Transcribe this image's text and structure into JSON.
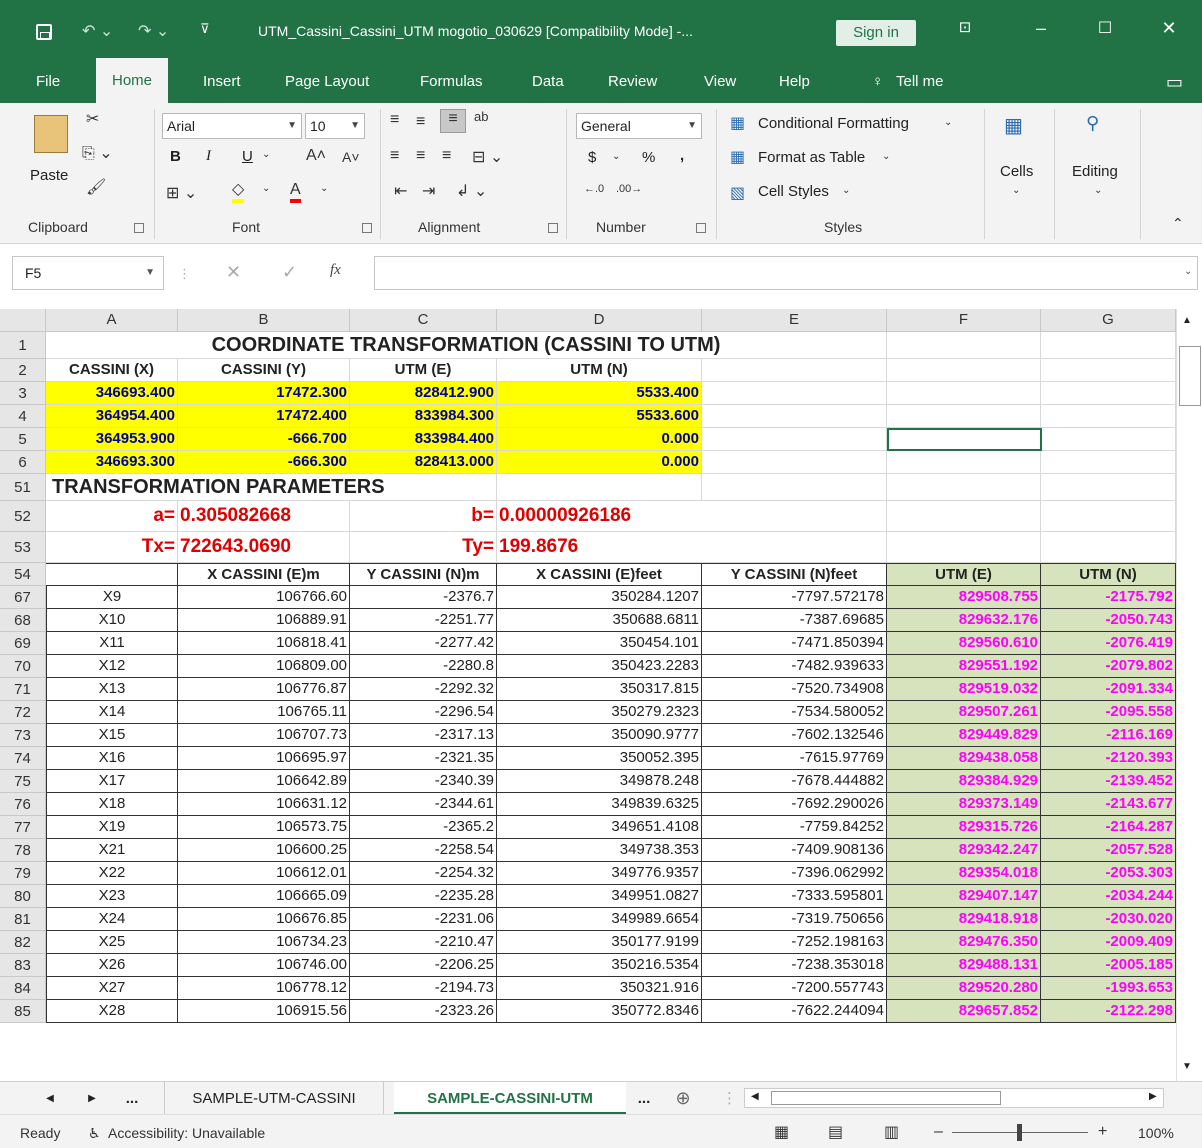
{
  "title_bar": {
    "title": "UTM_Cassini_Cassini_UTM mogotio_030629  [Compatibility Mode]  -...",
    "signin_label": "Sign in",
    "customize_glyph": "⊽"
  },
  "menu": {
    "file": "File",
    "home": "Home",
    "insert": "Insert",
    "page_layout": "Page Layout",
    "formulas": "Formulas",
    "data": "Data",
    "review": "Review",
    "view": "View",
    "help": "Help",
    "tell_me": "Tell me"
  },
  "ribbon": {
    "clipboard": {
      "label": "Clipboard",
      "paste": "Paste"
    },
    "font": {
      "label": "Font",
      "name": "Arial",
      "size": "10",
      "bold": "B",
      "italic": "I",
      "underline": "U"
    },
    "alignment": {
      "label": "Alignment"
    },
    "number": {
      "label": "Number",
      "format": "General",
      "currency": "$",
      "percent": "%",
      "comma": ","
    },
    "styles": {
      "label": "Styles",
      "conditional": "Conditional Formatting",
      "format_table": "Format as Table",
      "cell_styles": "Cell Styles"
    },
    "cells": {
      "label": "Cells"
    },
    "editing": {
      "label": "Editing"
    }
  },
  "formula_bar": {
    "name_box": "F5",
    "fx": "fx",
    "value": ""
  },
  "columns": [
    "A",
    "B",
    "C",
    "D",
    "E",
    "F",
    "G"
  ],
  "rows": [
    {
      "num": "1",
      "type": "title",
      "text": "COORDINATE TRANSFORMATION (CASSINI TO UTM)"
    },
    {
      "num": "2",
      "type": "hdr2",
      "cells": [
        "CASSINI (X)",
        "CASSINI (Y)",
        "UTM (E)",
        "UTM (N)"
      ]
    },
    {
      "num": "3",
      "type": "yellow",
      "cells": [
        "346693.400",
        "17472.300",
        "828412.900",
        "5533.400"
      ]
    },
    {
      "num": "4",
      "type": "yellow",
      "cells": [
        "364954.400",
        "17472.400",
        "833984.300",
        "5533.600"
      ]
    },
    {
      "num": "5",
      "type": "yellow",
      "cells": [
        "364953.900",
        "-666.700",
        "833984.400",
        "0.000"
      ]
    },
    {
      "num": "6",
      "type": "yellow",
      "cells": [
        "346693.300",
        "-666.300",
        "828413.000",
        "0.000"
      ]
    },
    {
      "num": "51",
      "type": "section",
      "text": "TRANSFORMATION PARAMETERS"
    },
    {
      "num": "52",
      "type": "param",
      "l1": "a=",
      "v1": "0.305082668",
      "l2": "b=",
      "v2": "0.00000926186"
    },
    {
      "num": "53",
      "type": "param",
      "l1": "Tx=",
      "v1": "722643.0690",
      "l2": "Ty=",
      "v2": "199.8676"
    },
    {
      "num": "54",
      "type": "hdr54",
      "cells": [
        "",
        "X CASSINI (E)m",
        "Y CASSINI (N)m",
        "X CASSINI (E)feet",
        "Y CASSINI (N)feet",
        "UTM (E)",
        "UTM (N)"
      ]
    },
    {
      "num": "67",
      "type": "data",
      "cells": [
        "X9",
        "106766.60",
        "-2376.7",
        "350284.1207",
        "-7797.572178",
        "829508.755",
        "-2175.792"
      ]
    },
    {
      "num": "68",
      "type": "data",
      "cells": [
        "X10",
        "106889.91",
        "-2251.77",
        "350688.6811",
        "-7387.69685",
        "829632.176",
        "-2050.743"
      ]
    },
    {
      "num": "69",
      "type": "data",
      "cells": [
        "X11",
        "106818.41",
        "-2277.42",
        "350454.101",
        "-7471.850394",
        "829560.610",
        "-2076.419"
      ]
    },
    {
      "num": "70",
      "type": "data",
      "cells": [
        "X12",
        "106809.00",
        "-2280.8",
        "350423.2283",
        "-7482.939633",
        "829551.192",
        "-2079.802"
      ]
    },
    {
      "num": "71",
      "type": "data",
      "cells": [
        "X13",
        "106776.87",
        "-2292.32",
        "350317.815",
        "-7520.734908",
        "829519.032",
        "-2091.334"
      ]
    },
    {
      "num": "72",
      "type": "data",
      "cells": [
        "X14",
        "106765.11",
        "-2296.54",
        "350279.2323",
        "-7534.580052",
        "829507.261",
        "-2095.558"
      ]
    },
    {
      "num": "73",
      "type": "data",
      "cells": [
        "X15",
        "106707.73",
        "-2317.13",
        "350090.9777",
        "-7602.132546",
        "829449.829",
        "-2116.169"
      ]
    },
    {
      "num": "74",
      "type": "data",
      "cells": [
        "X16",
        "106695.97",
        "-2321.35",
        "350052.395",
        "-7615.97769",
        "829438.058",
        "-2120.393"
      ]
    },
    {
      "num": "75",
      "type": "data",
      "cells": [
        "X17",
        "106642.89",
        "-2340.39",
        "349878.248",
        "-7678.444882",
        "829384.929",
        "-2139.452"
      ]
    },
    {
      "num": "76",
      "type": "data",
      "cells": [
        "X18",
        "106631.12",
        "-2344.61",
        "349839.6325",
        "-7692.290026",
        "829373.149",
        "-2143.677"
      ]
    },
    {
      "num": "77",
      "type": "data",
      "cells": [
        "X19",
        "106573.75",
        "-2365.2",
        "349651.4108",
        "-7759.84252",
        "829315.726",
        "-2164.287"
      ]
    },
    {
      "num": "78",
      "type": "data",
      "cells": [
        "X21",
        "106600.25",
        "-2258.54",
        "349738.353",
        "-7409.908136",
        "829342.247",
        "-2057.528"
      ]
    },
    {
      "num": "79",
      "type": "data",
      "cells": [
        "X22",
        "106612.01",
        "-2254.32",
        "349776.9357",
        "-7396.062992",
        "829354.018",
        "-2053.303"
      ]
    },
    {
      "num": "80",
      "type": "data",
      "cells": [
        "X23",
        "106665.09",
        "-2235.28",
        "349951.0827",
        "-7333.595801",
        "829407.147",
        "-2034.244"
      ]
    },
    {
      "num": "81",
      "type": "data",
      "cells": [
        "X24",
        "106676.85",
        "-2231.06",
        "349989.6654",
        "-7319.750656",
        "829418.918",
        "-2030.020"
      ]
    },
    {
      "num": "82",
      "type": "data",
      "cells": [
        "X25",
        "106734.23",
        "-2210.47",
        "350177.9199",
        "-7252.198163",
        "829476.350",
        "-2009.409"
      ]
    },
    {
      "num": "83",
      "type": "data",
      "cells": [
        "X26",
        "106746.00",
        "-2206.25",
        "350216.5354",
        "-7238.353018",
        "829488.131",
        "-2005.185"
      ]
    },
    {
      "num": "84",
      "type": "data",
      "cells": [
        "X27",
        "106778.12",
        "-2194.73",
        "350321.916",
        "-7200.557743",
        "829520.280",
        "-1993.653"
      ]
    },
    {
      "num": "85",
      "type": "data",
      "cells": [
        "X28",
        "106915.56",
        "-2323.26",
        "350772.8346",
        "-7622.244094",
        "829657.852",
        "-2122.298"
      ]
    }
  ],
  "sheet_tabs": {
    "tab1": "SAMPLE-UTM-CASSINI",
    "tab2": "SAMPLE-CASSINI-UTM",
    "more": "...",
    "ellipsis_left": "..."
  },
  "status": {
    "ready": "Ready",
    "accessibility": "Accessibility: Unavailable",
    "zoom": "100%"
  }
}
